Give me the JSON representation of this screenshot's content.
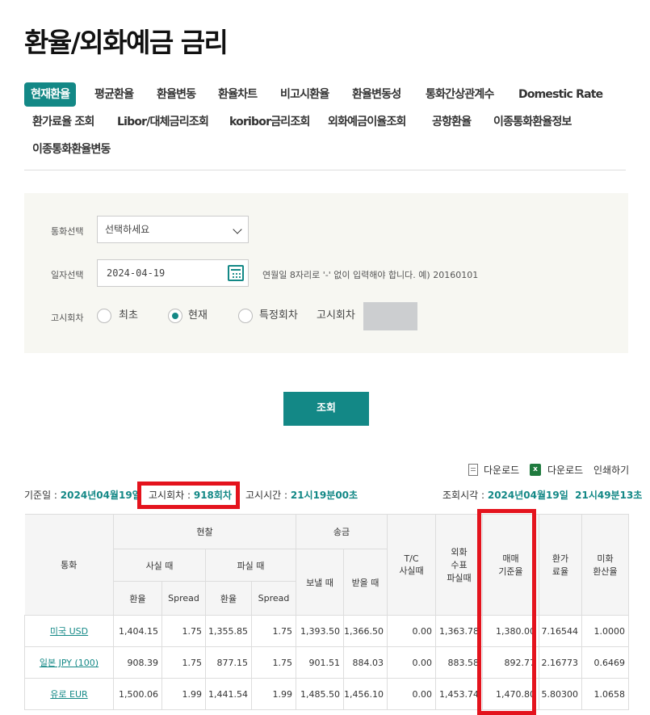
{
  "title": "환율/외화예금 금리",
  "tabs": {
    "row1": [
      "현재환율",
      "평균환율",
      "환율변동",
      "환율차트",
      "비고시환율",
      "환율변동성",
      "통화간상관계수",
      "Domestic Rate"
    ],
    "row2": [
      "환가료율 조회",
      "Libor/대체금리조회",
      "koribor금리조회",
      "외화예금이율조회",
      "공항환율",
      "이종통화환율정보"
    ],
    "row3": [
      "이종통화환율변동"
    ]
  },
  "form": {
    "currency_label": "통화선택",
    "currency_value": "선택하세요",
    "date_label": "일자선택",
    "date_value": "2024-04-19",
    "date_hint": "연월일 8자리로 '-' 없이 입력해야 합니다. 예) 20160101",
    "notice_label": "고시회차",
    "radio_first": "최초",
    "radio_current": "현재",
    "radio_specific": "특정회차",
    "notice_round_label": "고시회차",
    "search_button": "조회"
  },
  "downloads": {
    "download1": "다운로드",
    "download2": "다운로드",
    "print": "인쇄하기"
  },
  "info": {
    "base_date_label": "기준일 : ",
    "base_date": "2024년04월19일",
    "round_label": "고시회차 : ",
    "round": "918회차",
    "time_label": "고시시간 : ",
    "time": "21시19분00초",
    "query_label": "조회시각 : ",
    "query_time": "2024년04월19일  21시49분13초"
  },
  "table": {
    "headers": {
      "currency": "통화",
      "cash": "현찰",
      "buy": "사실 때",
      "sell": "파실 때",
      "remit": "송금",
      "send": "보낼 때",
      "receive": "받을 때",
      "tc": [
        "T/C",
        "사실때"
      ],
      "check": [
        "외화",
        "수표",
        "파실때"
      ],
      "base": [
        "매매",
        "기준율"
      ],
      "fee": [
        "환가",
        "료율"
      ],
      "usd": [
        "미화",
        "환산율"
      ],
      "rate": "환율",
      "spread": "Spread"
    },
    "rows": [
      {
        "currency": "미국 USD",
        "cash_buy": "1,404.15",
        "cash_buy_spread": "1.75",
        "cash_sell": "1,355.85",
        "cash_sell_spread": "1.75",
        "send": "1,393.50",
        "receive": "1,366.50",
        "tc": "0.00",
        "check": "1,363.78",
        "base": "1,380.00",
        "fee": "7.16544",
        "usd": "1.0000"
      },
      {
        "currency": "일본 JPY (100)",
        "cash_buy": "908.39",
        "cash_buy_spread": "1.75",
        "cash_sell": "877.15",
        "cash_sell_spread": "1.75",
        "send": "901.51",
        "receive": "884.03",
        "tc": "0.00",
        "check": "883.58",
        "base": "892.77",
        "fee": "2.16773",
        "usd": "0.6469"
      },
      {
        "currency": "유로 EUR",
        "cash_buy": "1,500.06",
        "cash_buy_spread": "1.99",
        "cash_sell": "1,441.54",
        "cash_sell_spread": "1.99",
        "send": "1,485.50",
        "receive": "1,456.10",
        "tc": "0.00",
        "check": "1,453.74",
        "base": "1,470.80",
        "fee": "5.80300",
        "usd": "1.0658"
      }
    ]
  },
  "colors": {
    "accent": "#138886",
    "highlight": "#e4131d"
  }
}
